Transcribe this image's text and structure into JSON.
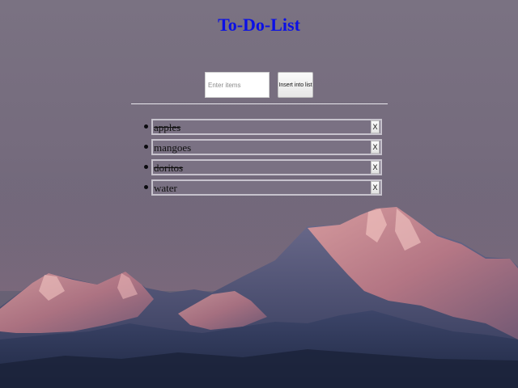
{
  "header": {
    "title": "To-Do-List"
  },
  "form": {
    "input_placeholder": "Enter items",
    "input_value": "",
    "insert_label": "Insert into list"
  },
  "list": {
    "items": [
      {
        "text": "apples",
        "done": true,
        "remove_label": "X"
      },
      {
        "text": "mangoes",
        "done": false,
        "remove_label": "X"
      },
      {
        "text": "doritos",
        "done": true,
        "remove_label": "X"
      },
      {
        "text": "water",
        "done": false,
        "remove_label": "X"
      }
    ]
  },
  "colors": {
    "title": "#0b10e6",
    "sky": "#7a7282",
    "item_border": "#c7c3cd",
    "peak_glow": "#d8898c"
  },
  "background": {
    "icon": "mountain-sunset-photo"
  }
}
